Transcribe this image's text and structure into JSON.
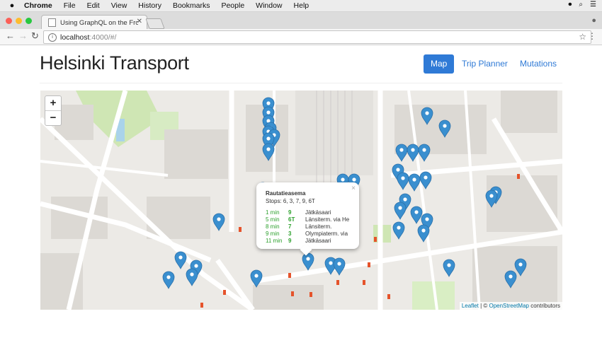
{
  "os_menubar": {
    "app": "Chrome",
    "items": [
      "File",
      "Edit",
      "View",
      "History",
      "Bookmarks",
      "People",
      "Window",
      "Help"
    ]
  },
  "browser": {
    "tab_title": "Using GraphQL on the Front-E",
    "url_host": "localhost",
    "url_path": ":4000/#/"
  },
  "app": {
    "title": "Helsinki Transport",
    "nav": [
      {
        "label": "Map",
        "active": true
      },
      {
        "label": "Trip Planner",
        "active": false
      },
      {
        "label": "Mutations",
        "active": false
      }
    ]
  },
  "map": {
    "zoom_in": "+",
    "zoom_out": "−",
    "attribution": {
      "leaflet": "Leaflet",
      "sep": " | © ",
      "osm": "OpenStreetMap",
      "suffix": " contributors"
    },
    "marker_color": "#3a8fcf",
    "popup": {
      "close": "×",
      "stop_name": "Rautatieasema",
      "stops_line": "Stops: 6, 3, 7, 9, 6T",
      "departures": [
        {
          "time": "1 min",
          "line": "9",
          "dest": "Jätkäsaari"
        },
        {
          "time": "5 min",
          "line": "6T",
          "dest": "Länsiterm. via He"
        },
        {
          "time": "8 min",
          "line": "7",
          "dest": "Länsiterm."
        },
        {
          "time": "9 min",
          "line": "3",
          "dest": "Olympiaterm. via"
        },
        {
          "time": "11 min",
          "line": "9",
          "dest": "Jätkäsaari"
        }
      ]
    }
  }
}
